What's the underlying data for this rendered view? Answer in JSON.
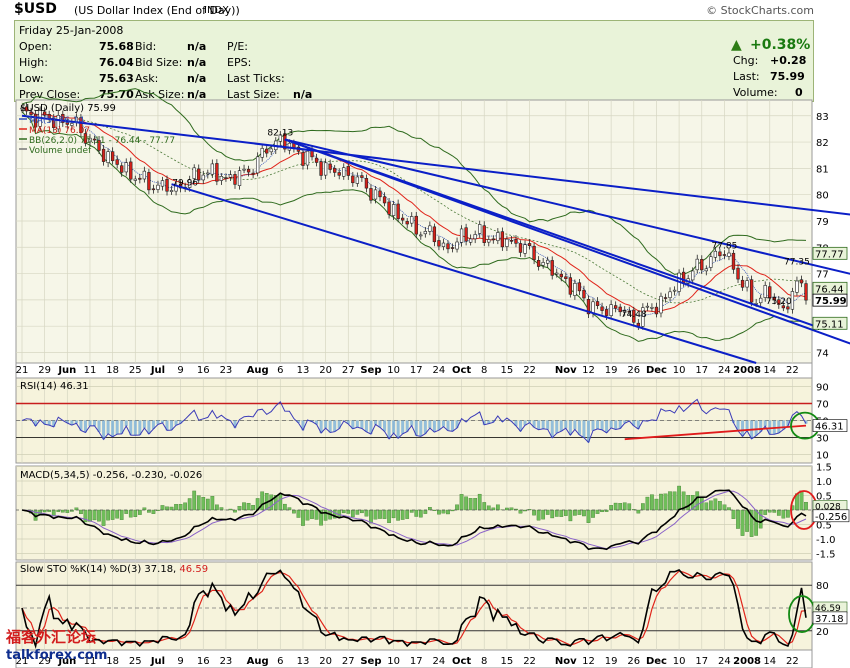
{
  "header": {
    "symbol": "$USD",
    "name": "(US Dollar Index (End of Day))",
    "exchange": "INDX",
    "brand": "© StockCharts.com"
  },
  "quote": {
    "date": "Friday  25-Jan-2008",
    "rows": [
      {
        "l1": "Open:",
        "v1": "75.68",
        "l2": "Bid:",
        "v2": "n/a",
        "l3": "P/E:",
        "v3": ""
      },
      {
        "l1": "High:",
        "v1": "76.04",
        "l2": "Bid Size:",
        "v2": "n/a",
        "l3": "EPS:",
        "v3": ""
      },
      {
        "l1": "Low:",
        "v1": "75.63",
        "l2": "Ask:",
        "v2": "n/a",
        "l3": "Last Ticks:",
        "v3": ""
      },
      {
        "l1": "Prev Close:",
        "v1": "75.70",
        "l2": "Ask Size:",
        "v2": "n/a",
        "l3": "Last Size:",
        "v3": "n/a"
      }
    ],
    "change_pct": "+0.38%",
    "chg_label": "Chg:",
    "chg": "+0.28",
    "last_label": "Last:",
    "last": "75.99",
    "vol_label": "Volume:",
    "volume": "0"
  },
  "watermark": {
    "cn": "福客外汇论坛",
    "en": "talkforex.com"
  },
  "chart_data": [
    {
      "type": "line",
      "title": "$USD (Daily) 75.99",
      "legend": [
        "MA(5) 76.14",
        "MA(13) 76.07",
        "BB(26,2.0) 75.11 - 76.44 - 77.77",
        "Volume undef"
      ],
      "ylim": [
        73.6,
        83.6
      ],
      "yticks": [
        74,
        75,
        76,
        77,
        78,
        79,
        80,
        81,
        82,
        83
      ],
      "x_ticks": [
        "21",
        "29",
        "Jun",
        "11",
        "18",
        "25",
        "Jul",
        "9",
        "16",
        "23",
        "Aug",
        "6",
        "13",
        "20",
        "27",
        "Sep",
        "10",
        "17",
        "24",
        "Oct",
        "8",
        "15",
        "22",
        "Nov",
        "12",
        "19",
        "26",
        "Dec",
        "10",
        "17",
        "24",
        "2008",
        "14",
        "22"
      ],
      "x_tick_idx": [
        0,
        5,
        10,
        15,
        20,
        25,
        30,
        35,
        40,
        45,
        52,
        57,
        62,
        67,
        72,
        77,
        82,
        87,
        92,
        97,
        102,
        107,
        112,
        120,
        125,
        130,
        135,
        140,
        145,
        150,
        155,
        160,
        165,
        170
      ],
      "n_points": 174,
      "anchors": [
        [
          0,
          83.1
        ],
        [
          8,
          82.8
        ],
        [
          12,
          82.7
        ],
        [
          15,
          82.0
        ],
        [
          22,
          81.0
        ],
        [
          28,
          80.4
        ],
        [
          34,
          80.2
        ],
        [
          40,
          80.9
        ],
        [
          46,
          80.6
        ],
        [
          50,
          80.9
        ],
        [
          55,
          81.9
        ],
        [
          57,
          82.1
        ],
        [
          60,
          81.7
        ],
        [
          64,
          81.3
        ],
        [
          68,
          80.9
        ],
        [
          72,
          80.8
        ],
        [
          76,
          80.3
        ],
        [
          81,
          79.5
        ],
        [
          86,
          78.8
        ],
        [
          90,
          78.5
        ],
        [
          94,
          77.9
        ],
        [
          97,
          78.4
        ],
        [
          100,
          78.5
        ],
        [
          105,
          78.3
        ],
        [
          110,
          78.1
        ],
        [
          114,
          77.5
        ],
        [
          118,
          77.0
        ],
        [
          122,
          76.4
        ],
        [
          126,
          75.7
        ],
        [
          128,
          75.6
        ],
        [
          132,
          75.7
        ],
        [
          135,
          75.2
        ],
        [
          137,
          75.5
        ],
        [
          141,
          75.9
        ],
        [
          145,
          76.7
        ],
        [
          149,
          77.2
        ],
        [
          151,
          77.4
        ],
        [
          153,
          77.7
        ],
        [
          155,
          77.8
        ],
        [
          157,
          77.3
        ],
        [
          159,
          76.5
        ],
        [
          162,
          76.0
        ],
        [
          165,
          76.3
        ],
        [
          166,
          76.0
        ],
        [
          168,
          75.6
        ],
        [
          171,
          76.5
        ],
        [
          173,
          77.0
        ],
        [
          174,
          76.3
        ],
        [
          175,
          75.8
        ],
        [
          176,
          75.99
        ]
      ],
      "annotations": [
        {
          "label": "82.13",
          "x": 57,
          "y": 82.1
        },
        {
          "label": "79.96",
          "x": 36,
          "y": 80.2
        },
        {
          "label": "74.48",
          "x": 135,
          "y": 75.2
        },
        {
          "label": "77.85",
          "x": 155,
          "y": 77.8
        },
        {
          "label": "77.35",
          "x": 171,
          "y": 77.2
        },
        {
          "label": "75.20",
          "x": 167,
          "y": 75.7
        }
      ],
      "right_labels": [
        {
          "label": "77.77",
          "y": 77.77
        },
        {
          "label": "76.44",
          "y": 76.44
        },
        {
          "label": "75.99",
          "y": 75.99
        },
        {
          "label": "75.11",
          "y": 75.11
        }
      ],
      "trendlines": [
        [
          [
            0,
            83.0
          ],
          [
            185,
            79.2
          ]
        ],
        [
          [
            58,
            82.1
          ],
          [
            185,
            76.9
          ]
        ],
        [
          [
            58,
            82.1
          ],
          [
            175,
            75.0
          ]
        ],
        [
          [
            58,
            82.1
          ],
          [
            185,
            74.2
          ]
        ],
        [
          [
            33,
            80.4
          ],
          [
            162,
            73.6
          ]
        ]
      ]
    },
    {
      "type": "line",
      "title": "RSI(14) 46.31",
      "ylim": [
        0,
        100
      ],
      "yticks": [
        10,
        30,
        50,
        70,
        90
      ],
      "last": "46.31"
    },
    {
      "type": "line",
      "title": "MACD(5,34,5) -0.256, -0.230, -0.026",
      "yticks": [
        -1.5,
        -1.0,
        -0.5,
        0.5,
        1.0,
        1.5
      ],
      "ytick_labels": [
        "-1.5",
        "-1.0",
        "0.5",
        "0.5",
        "1.0",
        "1.5"
      ],
      "last": [
        "0.028",
        "-0.256"
      ]
    },
    {
      "type": "line",
      "title": "Slow STO %K(14) %D(3) 37.18, 46.59",
      "ylim": [
        0,
        100
      ],
      "yticks": [
        20,
        50,
        80
      ],
      "last": [
        "46.59",
        "37.18"
      ]
    }
  ]
}
